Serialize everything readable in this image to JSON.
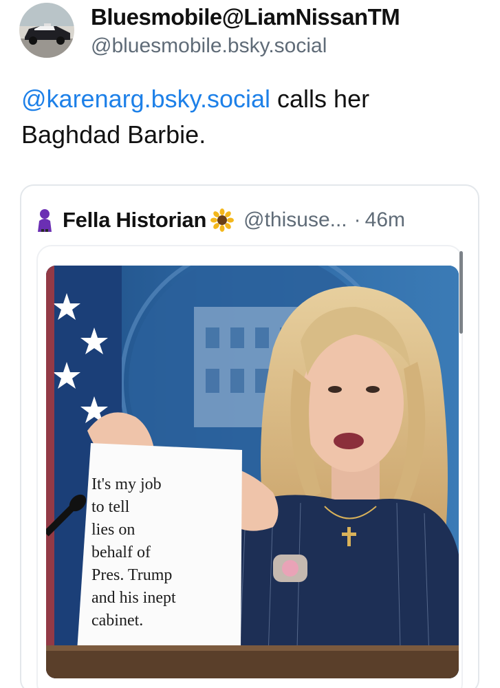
{
  "post": {
    "author": {
      "display_name": "Bluesmobile@LiamNissanTM",
      "handle": "@bluesmobile.bsky.social",
      "avatar_icon": "police-car-avatar"
    },
    "text": {
      "mention": "@karenarg.bsky.social",
      "rest": " calls her Baghdad Barbie."
    }
  },
  "quote": {
    "author_icon": "purple-person-icon",
    "display_name": "Fella Historian",
    "emoji": "sunflower-icon",
    "handle": "@thisuse...",
    "separator": "·",
    "time": "46m",
    "media": {
      "sign_lines": [
        "It's my job",
        "to tell",
        "lies on",
        "behalf of",
        "Pres. Trump",
        "and his inept",
        "cabinet."
      ]
    }
  },
  "colors": {
    "mention": "#1d80e8",
    "handle": "#5f6b77",
    "card_border": "#e3e7eb"
  }
}
